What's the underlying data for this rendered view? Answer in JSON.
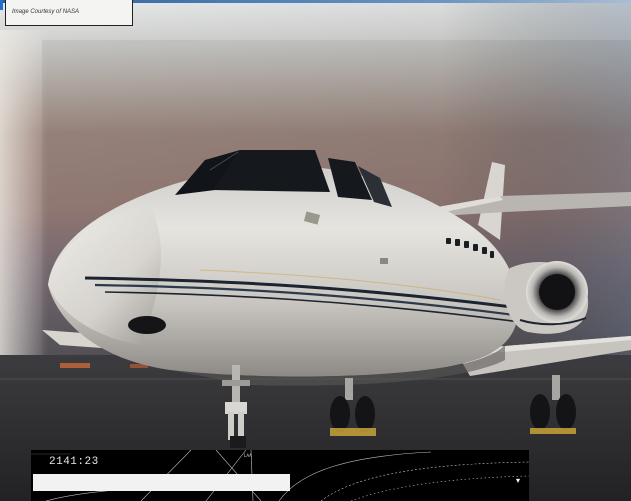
{
  "caption": {
    "text": "Image Courtesy of NASA"
  },
  "panel": {
    "clock": "2141:23",
    "progress_fraction": 0.52,
    "small_label": "LAA"
  },
  "colors": {
    "sky_top": "#dfe3e6",
    "sky_dusk": "#b98f7f",
    "tarmac": "#2a2a2c",
    "fuselage": "#e9e7e2",
    "stripe": "#1c2430",
    "panel_bg": "#000000",
    "progress": "#f2f2f2",
    "accent_blue": "#1e6fd0"
  },
  "icons": [
    "aircraft-photo",
    "dial-icon"
  ]
}
